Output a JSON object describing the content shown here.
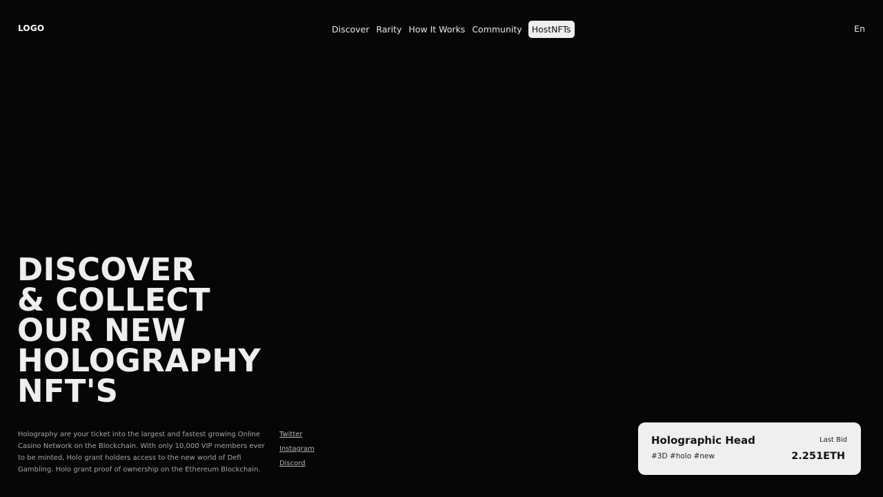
{
  "header": {
    "logo": "LOGO",
    "nav": [
      "Discover",
      "Rarity",
      "How It Works",
      "Community"
    ],
    "cta": "HostNFTs",
    "language": "En"
  },
  "hero": {
    "lines": [
      "DISCOVER",
      "& COLLECT",
      "OUR NEW",
      "HOLOGRAPHY",
      "NFT'S"
    ]
  },
  "description": "Holography are your ticket into the largest and fastest growing Online Casino Network on the Blockchain. With only 10,000 VIP members ever to be minted, Holo grant holders access to the new world of Defi Gambling. Holo grant proof of ownership on the Ethereum Blockchain.",
  "social": [
    "Twitter",
    "Instagram",
    "Discord"
  ],
  "card": {
    "title": "Holographic Head",
    "tags": "#3D #holo #new",
    "bid_label": "Last Bid",
    "bid_value": "2.251ETH"
  }
}
